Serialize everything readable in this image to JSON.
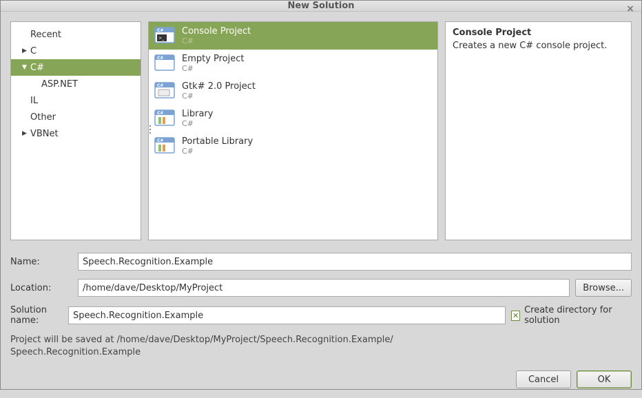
{
  "window": {
    "title": "New Solution"
  },
  "categories": {
    "items": [
      {
        "label": "Recent",
        "arrow": "",
        "cls": "noarrow"
      },
      {
        "label": "C",
        "arrow": "▶",
        "cls": ""
      },
      {
        "label": "C#",
        "arrow": "▼",
        "cls": "selected"
      },
      {
        "label": "ASP.NET",
        "arrow": "",
        "cls": "child"
      },
      {
        "label": "IL",
        "arrow": "",
        "cls": "noarrow"
      },
      {
        "label": "Other",
        "arrow": "",
        "cls": "noarrow"
      },
      {
        "label": "VBNet",
        "arrow": "▶",
        "cls": ""
      }
    ]
  },
  "templates": {
    "items": [
      {
        "name": "Console Project",
        "sub": "C#",
        "selected": true,
        "icon": "console"
      },
      {
        "name": "Empty Project",
        "sub": "C#",
        "selected": false,
        "icon": "empty"
      },
      {
        "name": "Gtk# 2.0 Project",
        "sub": "C#",
        "selected": false,
        "icon": "gtk"
      },
      {
        "name": "Library",
        "sub": "C#",
        "selected": false,
        "icon": "library"
      },
      {
        "name": "Portable Library",
        "sub": "C#",
        "selected": false,
        "icon": "library"
      }
    ]
  },
  "description": {
    "title": "Console Project",
    "body": "Creates a new C# console project."
  },
  "form": {
    "name_label": "Name:",
    "name_value": "Speech.Recognition.Example",
    "location_label": "Location:",
    "location_value": "/home/dave/Desktop/MyProject",
    "browse_label": "Browse...",
    "solution_label": "Solution name:",
    "solution_value": "Speech.Recognition.Example",
    "create_dir_label": "Create directory for solution",
    "create_dir_checked": true,
    "save_info_line1": "Project will be saved at /home/dave/Desktop/MyProject/Speech.Recognition.Example/",
    "save_info_line2": "Speech.Recognition.Example"
  },
  "buttons": {
    "cancel": "Cancel",
    "ok": "OK"
  },
  "colors": {
    "accent": "#87a556"
  }
}
